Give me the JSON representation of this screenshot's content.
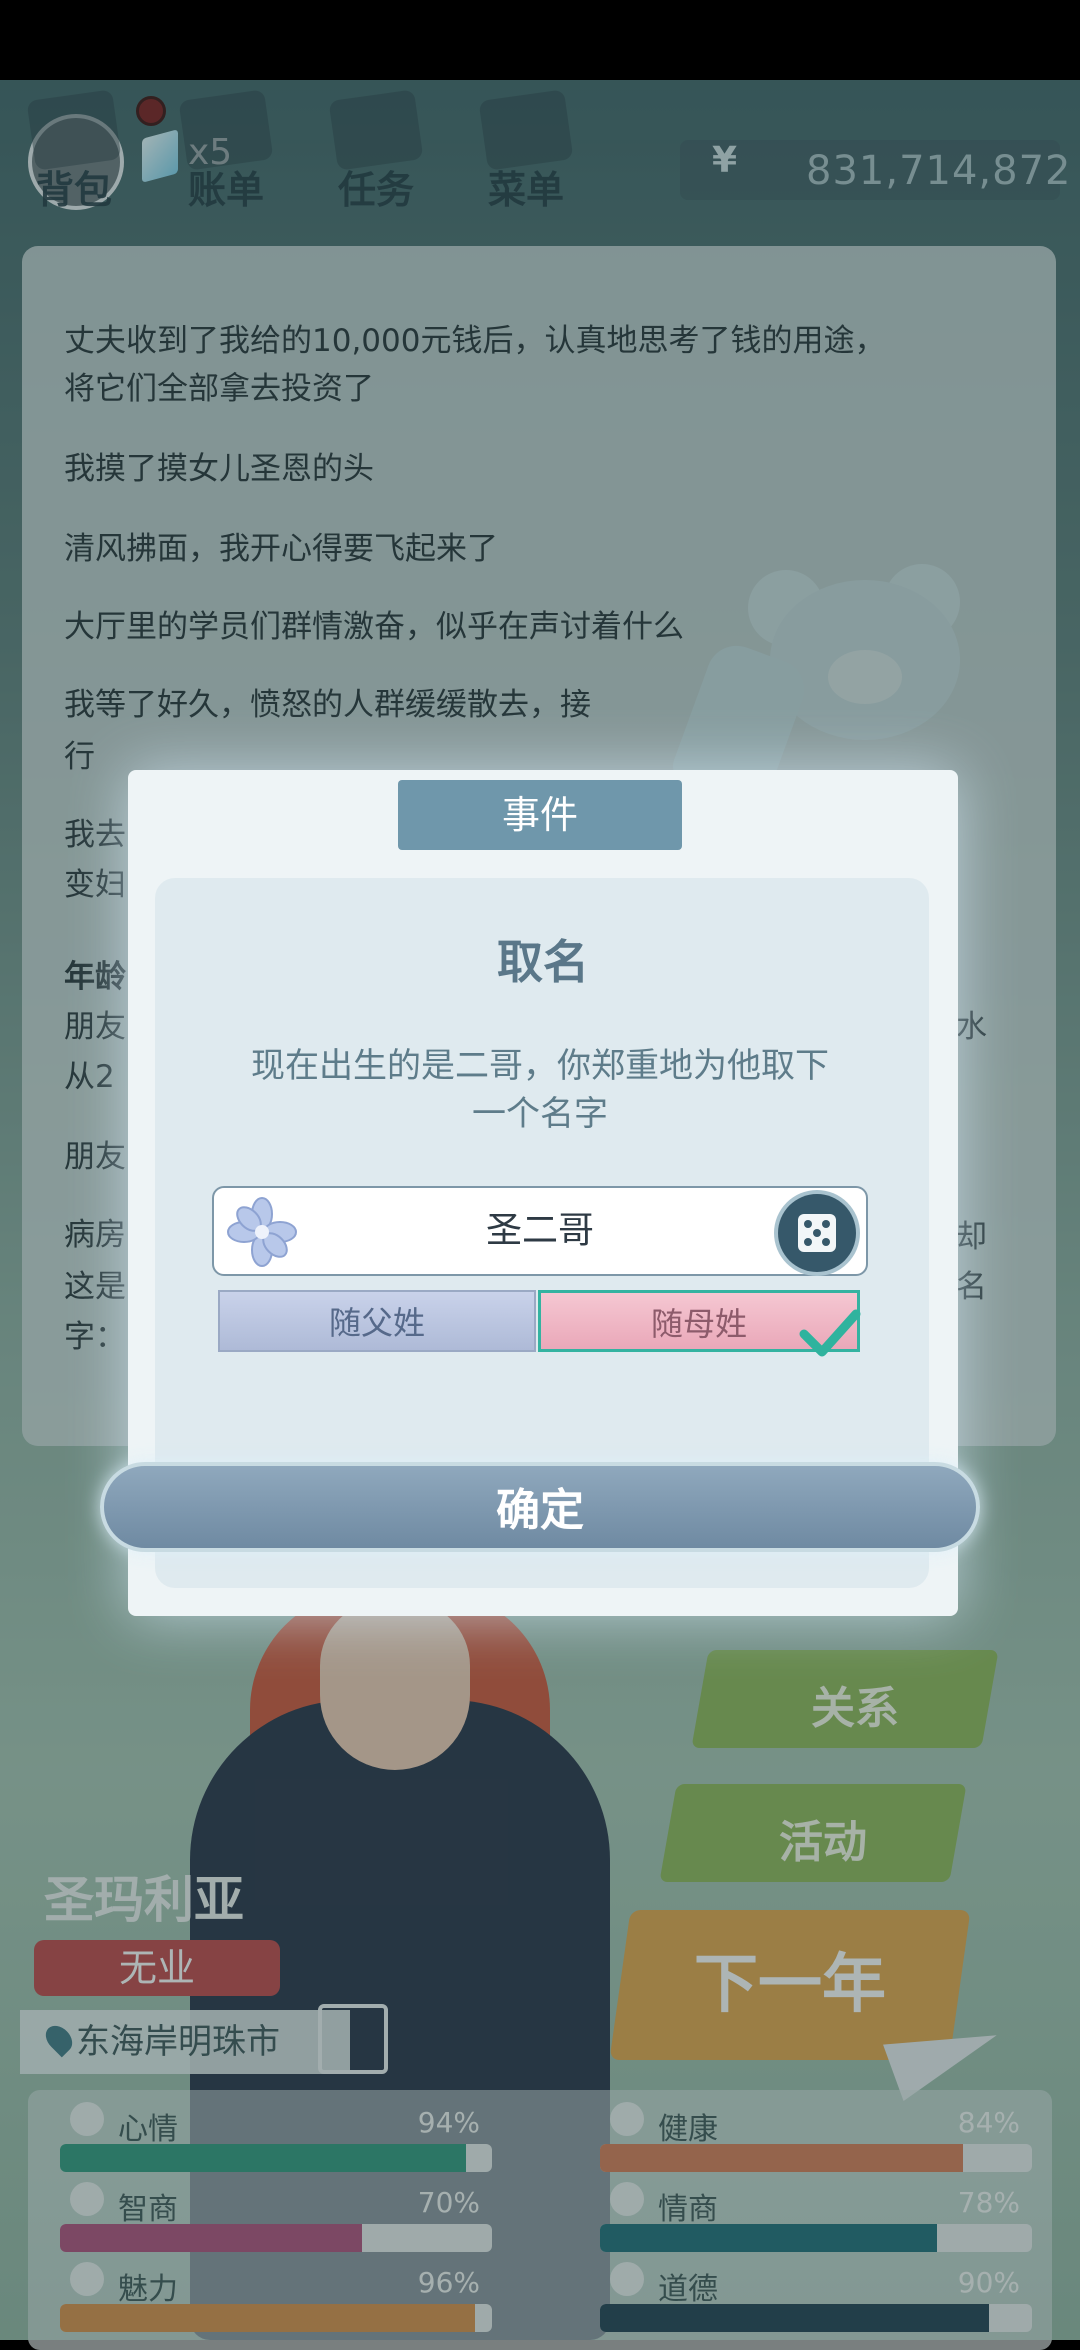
{
  "top_bar": {
    "tabs": [
      "背包",
      "账单",
      "任务",
      "菜单"
    ],
    "gem_count": "x5",
    "currency_symbol": "¥",
    "money": "831,714,872"
  },
  "story_lines": [
    "丈夫收到了我给的10,000元钱后，认真地思考了钱的用途，",
    "将它们全部拿去投资了",
    "我摸了摸女儿圣恩的头",
    "清风拂面，我开心得要飞起来了",
    "大厅里的学员们群情激奋，似乎在声讨着什么",
    "我等了好久，愤怒的人群缓缓散去，接",
    "行",
    "我去",
    "变妇",
    "年龄",
    "朋友",
    "从2",
    "朋友",
    "病房",
    "这是",
    "字："
  ],
  "story_right_fragments": [
    "水",
    "却",
    "名"
  ],
  "dialog": {
    "tab": "事件",
    "title": "取名",
    "description_line1": "现在出生的是二哥，你郑重地为他取下",
    "description_line2": "一个名字",
    "name_value": "圣二哥",
    "surname_father": "随父姓",
    "surname_mother": "随母姓",
    "selected_option": "随母姓",
    "confirm": "确定"
  },
  "side_buttons": {
    "relations": "关系",
    "activities": "活动",
    "next_year": "下一年"
  },
  "character": {
    "name": "圣玛利亚",
    "job": "无业",
    "location": "东海岸明珠市"
  },
  "stats": [
    {
      "name": "心情",
      "pct": "94%",
      "value": 0.94,
      "color": "#2f9a7f",
      "icon": "smile-icon"
    },
    {
      "name": "健康",
      "pct": "84%",
      "value": 0.84,
      "color": "#d77c56",
      "icon": "heart-icon"
    },
    {
      "name": "智商",
      "pct": "70%",
      "value": 0.7,
      "color": "#b0507c",
      "icon": "bulb-icon"
    },
    {
      "name": "情商",
      "pct": "78%",
      "value": 0.78,
      "color": "#1e6f7a",
      "icon": "apple-icon"
    },
    {
      "name": "魅力",
      "pct": "96%",
      "value": 0.96,
      "color": "#d9904a",
      "icon": "sparkle-icon"
    },
    {
      "name": "道德",
      "pct": "90%",
      "value": 0.9,
      "color": "#1f3f52",
      "icon": "scale-icon"
    }
  ]
}
